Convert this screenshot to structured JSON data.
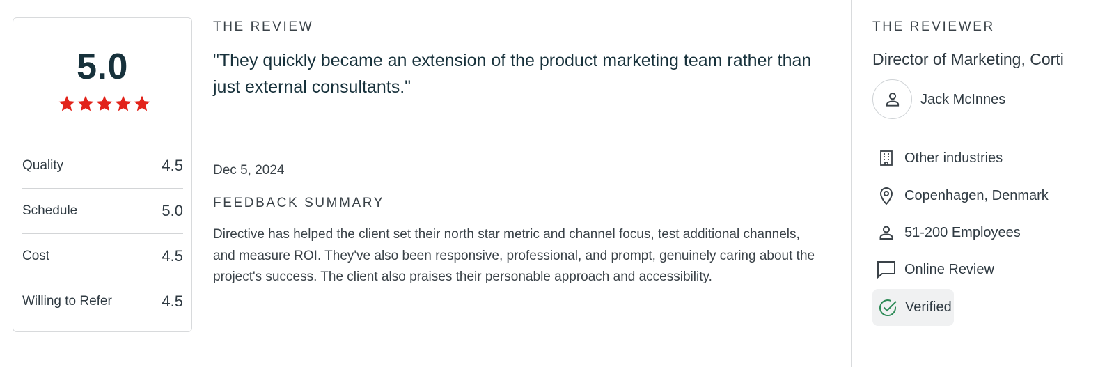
{
  "rating": {
    "overall": "5.0",
    "star_count": 5,
    "star_color": "#e2231a",
    "rows": [
      {
        "label": "Quality",
        "value": "4.5"
      },
      {
        "label": "Schedule",
        "value": "5.0"
      },
      {
        "label": "Cost",
        "value": "4.5"
      },
      {
        "label": "Willing to Refer",
        "value": "4.5"
      }
    ]
  },
  "review": {
    "section_label": "THE REVIEW",
    "quote": "\"They quickly became an extension of the product marketing team rather than just external consultants.\"",
    "date": "Dec 5, 2024",
    "feedback_label": "FEEDBACK SUMMARY",
    "feedback_text": "Directive has helped the client set their north star metric and channel focus, test additional channels, and measure ROI. They've also been responsive, professional, and prompt, genuinely caring about the project's success. The client also praises their personable approach and accessibility."
  },
  "reviewer": {
    "section_label": "THE REVIEWER",
    "role": "Director of Marketing, Corti",
    "name": "Jack McInnes",
    "avatar_icon": "person-icon",
    "details": [
      {
        "icon": "building-icon",
        "text": "Other industries"
      },
      {
        "icon": "location-pin-icon",
        "text": "Copenhagen, Denmark"
      },
      {
        "icon": "person-icon",
        "text": "51-200 Employees"
      },
      {
        "icon": "chat-bubble-icon",
        "text": "Online Review"
      }
    ],
    "verified": {
      "icon": "check-circle-icon",
      "text": "Verified",
      "color": "#2e8b57"
    }
  }
}
